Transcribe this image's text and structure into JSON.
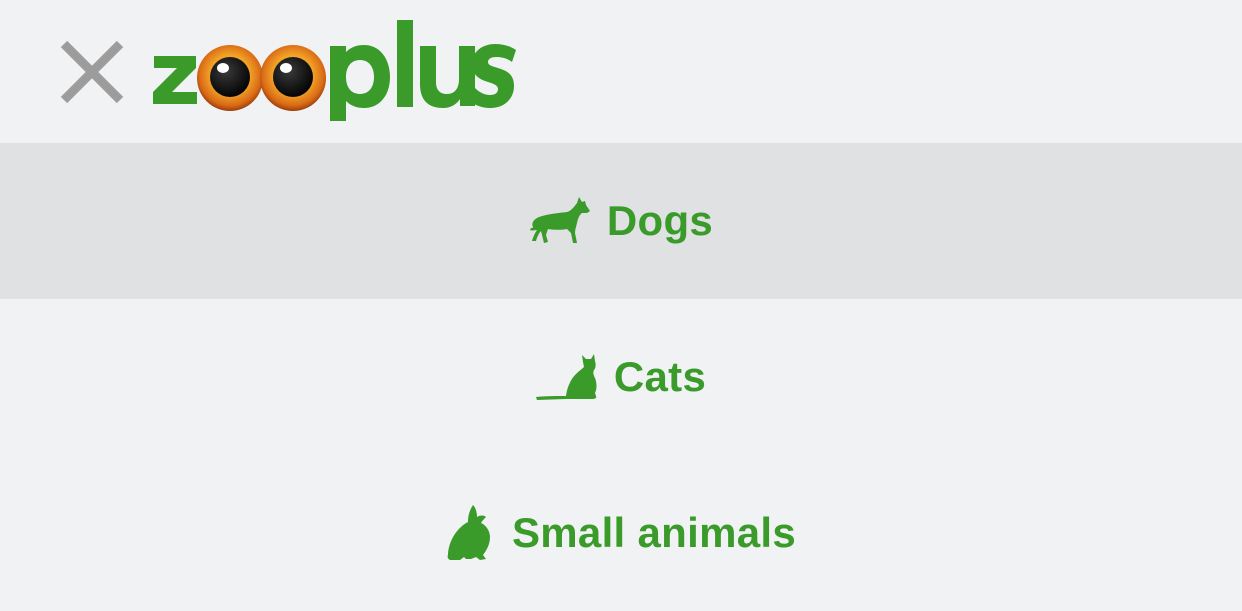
{
  "header": {
    "close_icon": "close-icon",
    "logo_text": "zooplus"
  },
  "menu": {
    "items": [
      {
        "label": "Dogs",
        "icon": "dog-icon",
        "active": true
      },
      {
        "label": "Cats",
        "icon": "cat-icon",
        "active": false
      },
      {
        "label": "Small animals",
        "icon": "rabbit-icon",
        "active": false
      }
    ]
  },
  "colors": {
    "brand_green": "#3a9a2a",
    "close_gray": "#9c9c9c",
    "background": "#f1f2f4",
    "active_row": "#e0e1e3",
    "eye_orange": "#e07a1c"
  }
}
